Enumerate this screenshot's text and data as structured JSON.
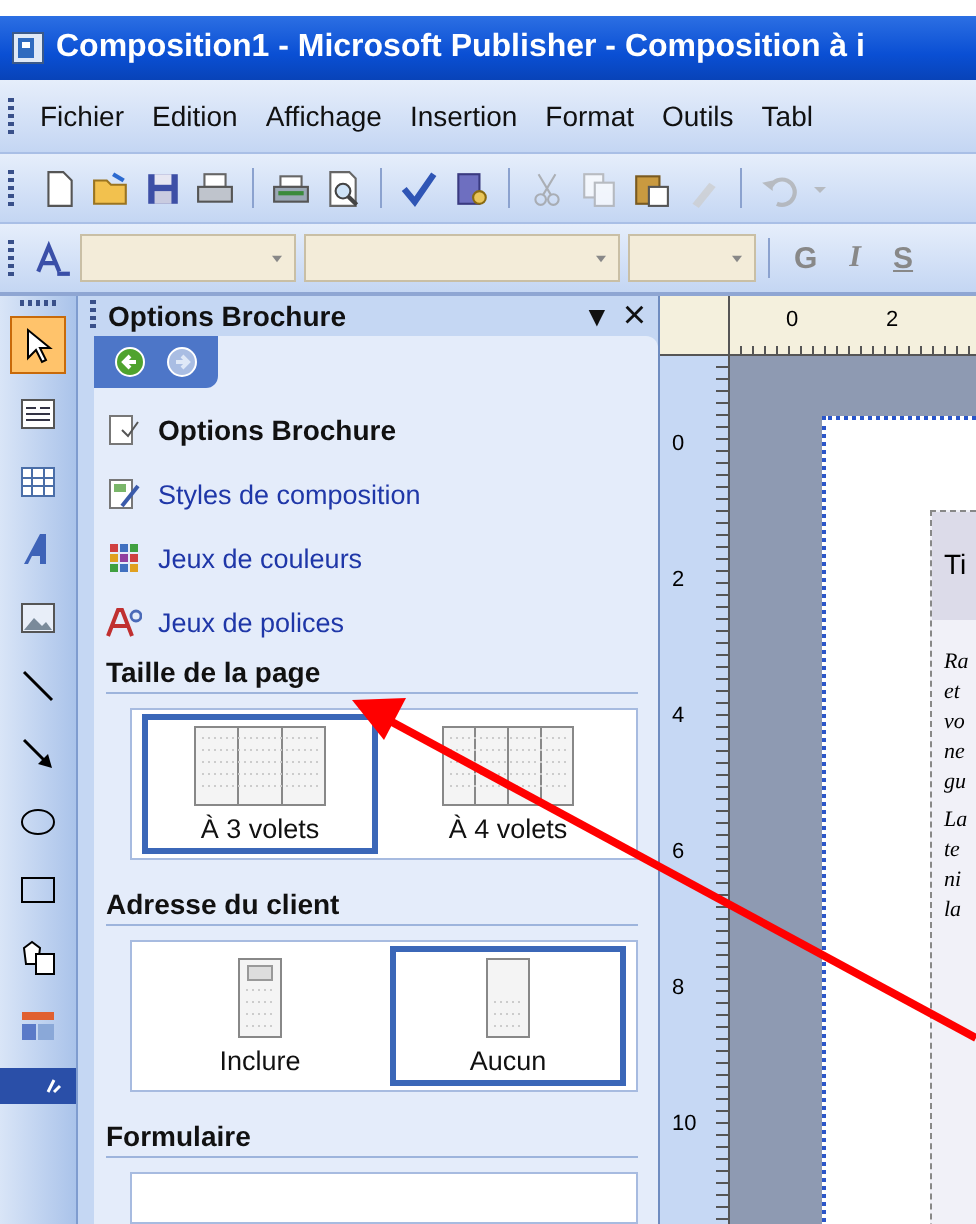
{
  "window": {
    "title": "Composition1 - Microsoft Publisher - Composition à i"
  },
  "menu": [
    "Fichier",
    "Edition",
    "Affichage",
    "Insertion",
    "Format",
    "Outils",
    "Tabl"
  ],
  "format_toolbar": {
    "buttons": [
      "G",
      "I",
      "S"
    ]
  },
  "tools": [
    {
      "selected": true
    },
    {
      "selected": false
    },
    {
      "selected": false
    },
    {
      "selected": false
    },
    {
      "selected": false
    },
    {
      "selected": false
    },
    {
      "selected": false
    },
    {
      "selected": false
    },
    {
      "selected": false
    },
    {
      "selected": false
    },
    {
      "selected": false
    }
  ],
  "task_pane": {
    "title": "Options Brochure",
    "menu_glyph": "▼",
    "close_glyph": "×",
    "nav": [
      {
        "disabled": false
      },
      {
        "disabled": true
      }
    ],
    "links": [
      {
        "label": "Options Brochure",
        "current": true
      },
      {
        "label": "Styles de composition",
        "current": false
      },
      {
        "label": "Jeux de couleurs",
        "current": false
      },
      {
        "label": "Jeux de polices",
        "current": false
      }
    ],
    "sections": [
      {
        "title": "Taille de la page",
        "options": [
          {
            "label": "À 3 volets",
            "selected": true,
            "kind": "panels3"
          },
          {
            "label": "À 4 volets",
            "selected": false,
            "kind": "panels4"
          }
        ]
      },
      {
        "title": "Adresse du client",
        "options": [
          {
            "label": "Inclure",
            "selected": false,
            "kind": "address"
          },
          {
            "label": "Aucun",
            "selected": true,
            "kind": "blank"
          }
        ]
      },
      {
        "title": "Formulaire"
      }
    ]
  },
  "rulers": {
    "horizontal": [
      "0",
      "2"
    ],
    "vertical": [
      "0",
      "2",
      "4",
      "6",
      "8",
      "10"
    ]
  },
  "document": {
    "title": "Ti",
    "paragraphs": [
      [
        "Ra",
        "et",
        "vo",
        "ne",
        "gu"
      ],
      [
        "La",
        "te",
        "ni",
        "la"
      ]
    ]
  }
}
